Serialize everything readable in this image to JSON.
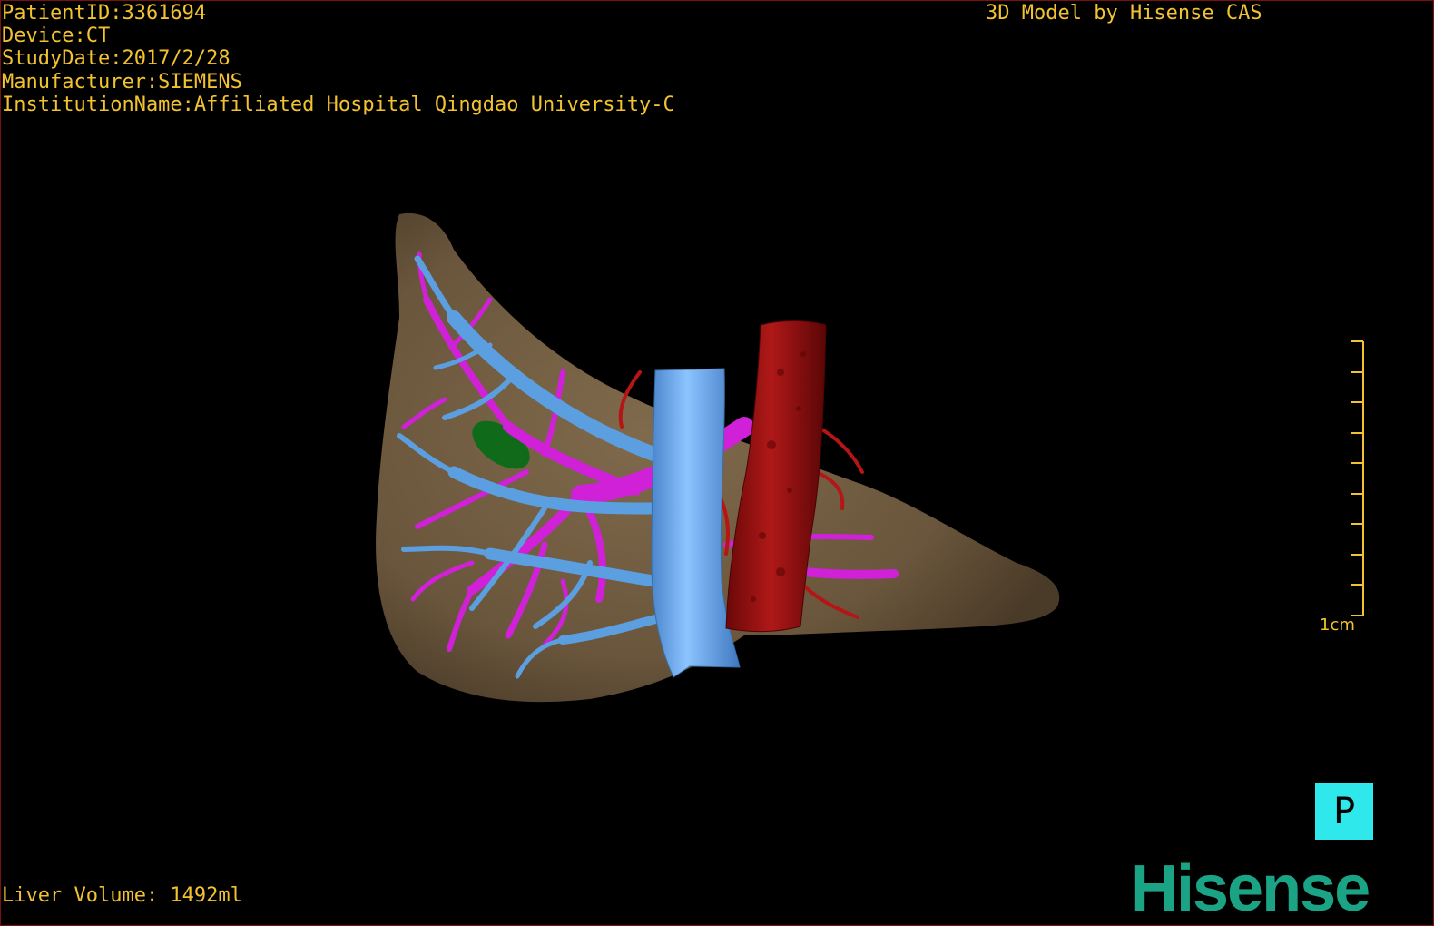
{
  "overlay": {
    "patient_id": "PatientID:3361694",
    "device": "Device:CT",
    "study_date": "StudyDate:2017/2/28",
    "manufacturer": "Manufacturer:SIEMENS",
    "institution": "InstitutionName:Affiliated Hospital Qingdao University-C",
    "credit": "3D Model by Hisense CAS",
    "liver_volume": "Liver Volume: 1492ml"
  },
  "scale_bar": {
    "label": "1cm"
  },
  "orientation_button": {
    "label": "P"
  },
  "brand": {
    "logo_text": "Hisense",
    "color": "#1aa385"
  },
  "colors": {
    "text": "#f2c230",
    "liver": "#7a6448",
    "hepatic_vein": "#5b9fe0",
    "portal_vein": "#d020d8",
    "artery": "#a01212",
    "gallbladder": "#0f6a1a",
    "orientation_bg": "#2ee8ec"
  }
}
